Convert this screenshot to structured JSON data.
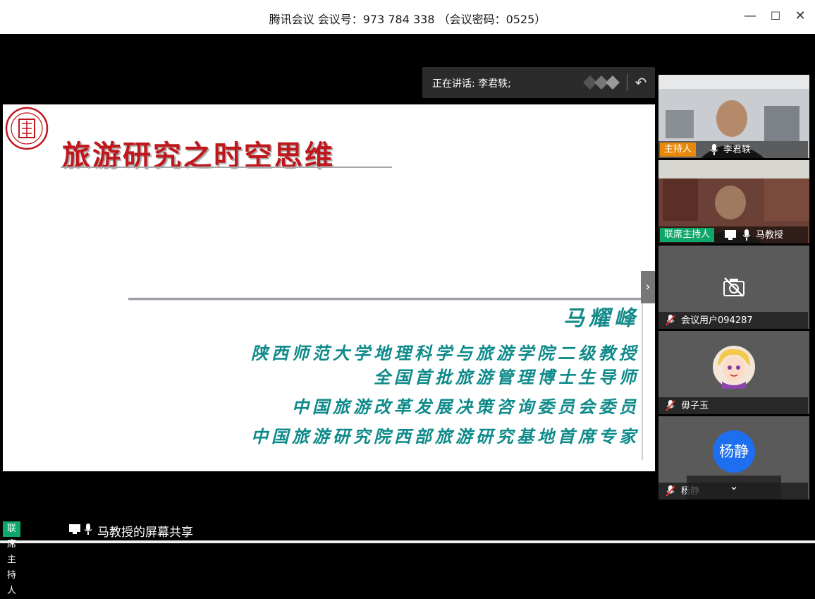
{
  "window": {
    "title": "腾讯会议 会议号：973 784 338 （会议密码：0525）",
    "minimize": "—",
    "maximize": "☐",
    "close": "✕"
  },
  "speaker_bar": {
    "text": "正在讲话: 李君轶;"
  },
  "slide": {
    "title": "旅游研究之时空思维",
    "presenter": "马耀峰",
    "lines": [
      "陕西师范大学地理科学与旅游学院二级教授",
      "全国首批旅游管理博士生导师",
      "中国旅游改革发展决策咨询委员会委员",
      "中国旅游研究院西部旅游研究基地首席专家"
    ]
  },
  "participants": [
    {
      "role": "主持人",
      "name": "李君轶",
      "type": "video"
    },
    {
      "role": "联席主持人",
      "name": "马教授",
      "type": "video"
    },
    {
      "role": "",
      "name": "会议用户094287",
      "type": "camera-off"
    },
    {
      "role": "",
      "name": "毋子玉",
      "type": "avatar"
    },
    {
      "role": "",
      "name": "杨静",
      "type": "initials",
      "initials": "杨静"
    }
  ],
  "bottom": {
    "badge": "联席主持人",
    "share_text": "马教授的屏幕共享"
  },
  "colors": {
    "host_badge": "#e8890c",
    "cohost_badge": "#0fa66b",
    "title_red": "#c0171d",
    "teal_text": "#0f8a8a",
    "avatar_blue": "#1e6ff0"
  }
}
